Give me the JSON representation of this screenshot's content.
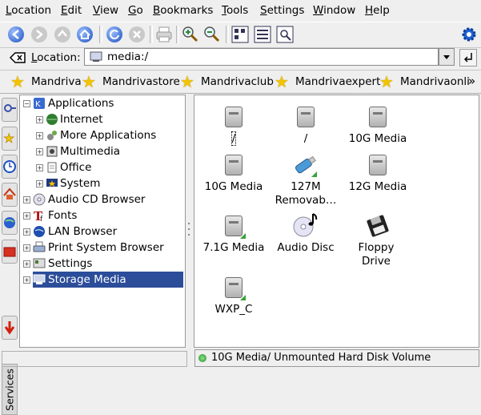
{
  "menubar": {
    "items": [
      {
        "first": "L",
        "rest": "ocation"
      },
      {
        "first": "E",
        "rest": "dit"
      },
      {
        "first": "V",
        "rest": "iew"
      },
      {
        "first": "G",
        "rest": "o"
      },
      {
        "first": "B",
        "rest": "ookmarks"
      },
      {
        "first": "T",
        "rest": "ools"
      },
      {
        "first": "S",
        "rest": "ettings"
      },
      {
        "first": "W",
        "rest": "indow"
      },
      {
        "first": "H",
        "rest": "elp"
      }
    ]
  },
  "location": {
    "label_first": "L",
    "label_rest": "ocation:",
    "value": "media:/"
  },
  "bookmarks": [
    "Mandriva",
    "Mandrivastore",
    "Mandrivaclub",
    "Mandrivaexpert",
    "Mandrivaonli"
  ],
  "bookmarks_overflow": "»",
  "sidebar": {
    "services_tab": "Services"
  },
  "tree": {
    "root": "Applications",
    "children": [
      "Internet",
      "More Applications",
      "Multimedia",
      "Office",
      "System"
    ],
    "top": [
      "Audio CD Browser",
      "Fonts",
      "LAN Browser",
      "Print System Browser",
      "Settings",
      "Storage Media"
    ],
    "selected": "Storage Media"
  },
  "icons": [
    {
      "label": "/",
      "type": "hdd",
      "mounted": false,
      "focused": true
    },
    {
      "label": "/",
      "type": "hdd",
      "mounted": false
    },
    {
      "label": "10G Media",
      "type": "hdd",
      "mounted": false
    },
    {
      "label": "10G Media",
      "type": "hdd",
      "mounted": false
    },
    {
      "label": "127M Removab…",
      "type": "usb",
      "mounted": true
    },
    {
      "label": "12G Media",
      "type": "hdd",
      "mounted": false
    },
    {
      "label": "7.1G Media",
      "type": "hdd",
      "mounted": true
    },
    {
      "label": "Audio Disc",
      "type": "cd"
    },
    {
      "label": "Floppy Drive",
      "type": "floppy"
    },
    {
      "label": "WXP_C",
      "type": "hdd",
      "mounted": true
    }
  ],
  "status": {
    "text": "10G Media/  Unmounted Hard Disk Volume"
  },
  "colors": {
    "selection": "#2b4d9a",
    "star": "#f2c300",
    "mounted": "#3aa03a"
  }
}
